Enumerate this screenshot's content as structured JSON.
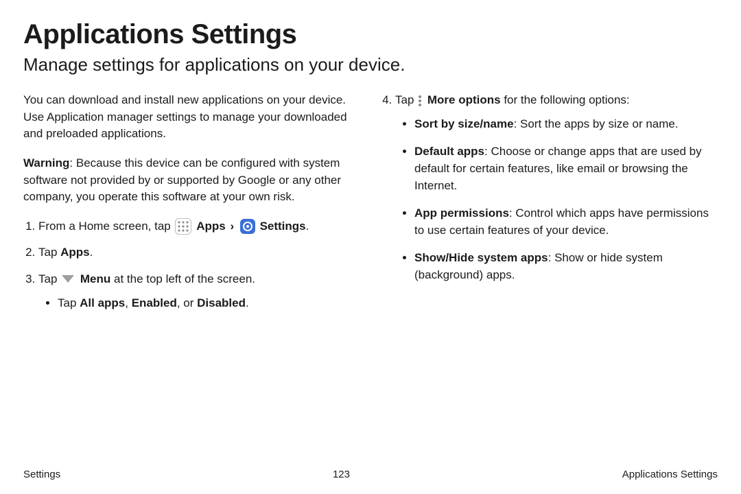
{
  "title": "Applications Settings",
  "subtitle": "Manage settings for applications on your device.",
  "intro_paragraph": "You can download and install new applications on your device. Use Application manager settings to manage your downloaded and preloaded applications.",
  "warning_label": "Warning",
  "warning_text": ": Because this device can be configured with system software not provided by or supported by Google or any other company, you operate this software at your own risk.",
  "step1_prefix": "From a Home screen, tap ",
  "step1_apps_label": "Apps",
  "step1_chevron": " › ",
  "step1_settings_label": "Settings",
  "step1_suffix": ".",
  "step2_prefix": "Tap ",
  "step2_label": "Apps",
  "step2_suffix": ".",
  "step3_prefix": "Tap ",
  "step3_menu_label": "Menu",
  "step3_suffix": " at the top left of the screen.",
  "step3_sub_prefix": "Tap ",
  "step3_sub_all": "All apps",
  "step3_sub_comma": ", ",
  "step3_sub_enabled": "Enabled",
  "step3_sub_or": ", or ",
  "step3_sub_disabled": "Disabled",
  "step3_sub_suffix": ".",
  "step4_prefix": "Tap ",
  "step4_label": "More options",
  "step4_suffix": " for the following options:",
  "opt1_label": "Sort by size/name",
  "opt1_text": ": Sort the apps by size or name.",
  "opt2_label": "Default apps",
  "opt2_text": ": Choose or change apps that are used by default for certain features, like email or browsing the Internet.",
  "opt3_label": "App permissions",
  "opt3_text": ": Control which apps have permissions to use certain features of your device.",
  "opt4_label": "Show/Hide system apps",
  "opt4_text": ": Show or hide system (background) apps.",
  "footer_left": "Settings",
  "footer_page": "123",
  "footer_right": "Applications Settings"
}
